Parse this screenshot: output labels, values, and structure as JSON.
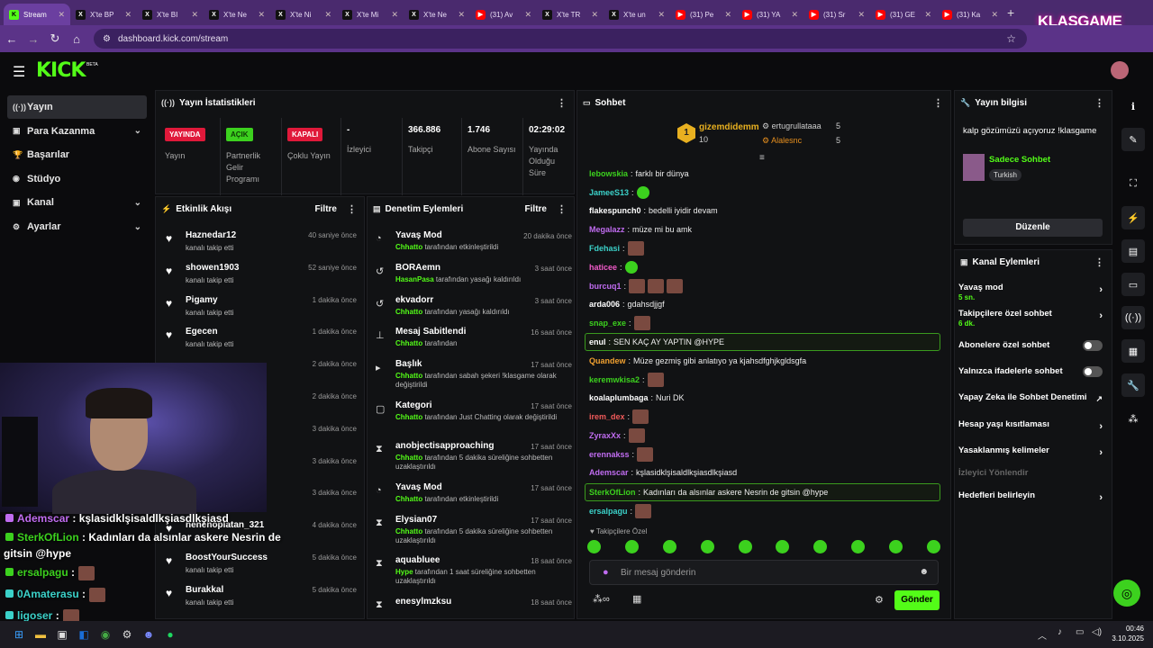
{
  "browser": {
    "tabs": [
      {
        "icon": "kick",
        "label": "Stream"
      },
      {
        "icon": "x",
        "label": "X'te BP"
      },
      {
        "icon": "x",
        "label": "X'te BI"
      },
      {
        "icon": "x",
        "label": "X'te Ne"
      },
      {
        "icon": "x",
        "label": "X'te Ni"
      },
      {
        "icon": "x",
        "label": "X'te Mi"
      },
      {
        "icon": "x",
        "label": "X'te Ne"
      },
      {
        "icon": "yt",
        "label": "(31) Av"
      },
      {
        "icon": "x",
        "label": "X'te TR"
      },
      {
        "icon": "x",
        "label": "X'te un"
      },
      {
        "icon": "yt",
        "label": "(31) Pe"
      },
      {
        "icon": "yt",
        "label": "(31) YA"
      },
      {
        "icon": "yt",
        "label": "(31) Sr"
      },
      {
        "icon": "yt",
        "label": "(31) GE"
      },
      {
        "icon": "yt",
        "label": "(31) Ka"
      }
    ],
    "url": "dashboard.kick.com/stream",
    "overlay_logo": "KLASGAME"
  },
  "sidebar": {
    "items": [
      {
        "icon": "((·))",
        "label": "Yayın"
      },
      {
        "icon": "▣",
        "label": "Para Kazanma"
      },
      {
        "icon": "🏆",
        "label": "Başarılar"
      },
      {
        "icon": "◉",
        "label": "Stüdyo"
      },
      {
        "icon": "▣",
        "label": "Kanal"
      },
      {
        "icon": "⚙",
        "label": "Ayarlar"
      }
    ]
  },
  "stats": {
    "title": "Yayın İstatistikleri",
    "cells": [
      {
        "badge": "YAYINDA",
        "label": "Yayın"
      },
      {
        "badge": "AÇIK",
        "label": "Partnerlik Gelir Programı"
      },
      {
        "badge": "KAPALI",
        "label": "Çoklu Yayın"
      },
      {
        "value": "-",
        "label": "İzleyici"
      },
      {
        "value": "366.886",
        "label": "Takipçi"
      },
      {
        "value": "1.746",
        "label": "Abone Sayısı"
      },
      {
        "value": "02:29:02",
        "label": "Yayında Olduğu Süre"
      }
    ]
  },
  "activity": {
    "title": "Etkinlik Akışı",
    "filter": "Filtre",
    "items": [
      {
        "name": "Haznedar12",
        "sub": "kanalı takip etti",
        "time": "40 saniye önce"
      },
      {
        "name": "showen1903",
        "sub": "kanalı takip etti",
        "time": "52 saniye önce"
      },
      {
        "name": "Pigamy",
        "sub": "kanalı takip etti",
        "time": "1 dakika önce"
      },
      {
        "name": "Egecen",
        "sub": "kanalı takip etti",
        "time": "1 dakika önce"
      },
      {
        "name": "",
        "sub": "",
        "time": "2 dakika önce"
      },
      {
        "name": "",
        "sub": "",
        "time": "2 dakika önce"
      },
      {
        "name": "",
        "sub": "",
        "time": "3 dakika önce"
      },
      {
        "name": "",
        "sub": "",
        "time": "3 dakika önce"
      },
      {
        "name": "",
        "sub": "",
        "time": "3 dakika önce"
      },
      {
        "name": "nenenoplatan_321",
        "sub": "",
        "time": "4 dakika önce"
      },
      {
        "name": "BoostYourSuccess",
        "sub": "kanalı takip etti",
        "time": "5 dakika önce"
      },
      {
        "name": "Burakkal",
        "sub": "kanalı takip etti",
        "time": "5 dakika önce"
      }
    ]
  },
  "moderation": {
    "title": "Denetim Eylemleri",
    "filter": "Filtre",
    "items": [
      {
        "icon": "◔",
        "name": "Yavaş Mod",
        "actor": "Chhatto",
        "sub": " tarafından etkinleştirildi",
        "time": "20 dakika önce"
      },
      {
        "icon": "↺",
        "name": "BORAemn",
        "actor": "HasanPasa",
        "sub": " tarafından yasağı kaldırıldı",
        "time": "3 saat önce"
      },
      {
        "icon": "↺",
        "name": "ekvadorr",
        "actor": "Chhatto",
        "sub": " tarafından yasağı kaldırıldı",
        "time": "3 saat önce"
      },
      {
        "icon": "⊥",
        "name": "Mesaj Sabitlendi",
        "actor": "Chhatto",
        "sub": " tarafından",
        "time": "16 saat önce"
      },
      {
        "icon": "▸",
        "name": "Başlık",
        "actor": "Chhatto",
        "sub": " tarafından sabah şekeri !klasgame olarak değiştirildi",
        "time": "17 saat önce"
      },
      {
        "icon": "▢",
        "name": "Kategori",
        "actor": "Chhatto",
        "sub": " tarafından Just Chatting olarak değiştirildi",
        "time": "17 saat önce"
      },
      {
        "icon": "⧗",
        "name": "anobjectisapproaching",
        "actor": "Chhatto",
        "sub": " tarafından 5 dakika süreliğine sohbetten uzaklaştırıldı",
        "time": "17 saat önce"
      },
      {
        "icon": "◔",
        "name": "Yavaş Mod",
        "actor": "Chhatto",
        "sub": " tarafından etkinleştirildi",
        "time": "17 saat önce"
      },
      {
        "icon": "⧗",
        "name": "Elysian07",
        "actor": "Chhatto",
        "sub": " tarafından 5 dakika süreliğine sohbetten uzaklaştırıldı",
        "time": "17 saat önce"
      },
      {
        "icon": "⧗",
        "name": "aquabluee",
        "actor": "Hype",
        "sub": " tarafından 1 saat süreliğine sohbetten uzaklaştırıldı",
        "time": "18 saat önce"
      },
      {
        "icon": "⧗",
        "name": "enesylmzksu",
        "actor": "",
        "sub": "",
        "time": "18 saat önce"
      }
    ]
  },
  "chat": {
    "title": "Sohbet",
    "top": [
      {
        "rank": "1",
        "name": "gizemdidemm",
        "count": "10"
      },
      {
        "name": "ertugrullataaa",
        "count": "5"
      },
      {
        "name": "Alalesnc",
        "count": "5"
      }
    ],
    "lines": [
      {
        "user": "lebowskia",
        "color": "#3cd11e",
        "text": "farklı bir dünya"
      },
      {
        "user": "JameeS13",
        "color": "#3bd1c9",
        "text": ""
      },
      {
        "user": "flakespunch0",
        "color": "#ffffff",
        "text": "bedelli iyidir devam"
      },
      {
        "user": "Megalazz",
        "color": "#c06cf0",
        "text": "müze mi bu amk"
      },
      {
        "user": "Fdehasi",
        "color": "#3bd1c9",
        "text": ""
      },
      {
        "user": "haticee",
        "color": "#f05ac8",
        "text": ""
      },
      {
        "user": "burcuq1",
        "color": "#c06cf0",
        "text": ""
      },
      {
        "user": "arda006",
        "color": "#ffffff",
        "text": "gdahsdjjgf"
      },
      {
        "user": "snap_exe",
        "color": "#3cd11e",
        "text": ""
      },
      {
        "user": "enul",
        "color": "#ffffff",
        "text": "SEN KAÇ AY YAPTIN @HYPE"
      },
      {
        "user": "Quandew",
        "color": "#f0a030",
        "text": "Müze gezmiş gibi anlatıyo ya kjahsdfghjkgldsgfa"
      },
      {
        "user": "keremwkisa2",
        "color": "#3cd11e",
        "text": ""
      },
      {
        "user": "koalaplumbaga",
        "color": "#ffffff",
        "text": "Nuri DK"
      },
      {
        "user": "irem_dex",
        "color": "#f05a5a",
        "text": ""
      },
      {
        "user": "ZyraxXx",
        "color": "#c06cf0",
        "text": ""
      },
      {
        "user": "erennakss",
        "color": "#c06cf0",
        "text": ""
      },
      {
        "user": "Ademscar",
        "color": "#c06cf0",
        "text": "kşlasidklşisaldlkşiasdlkşiasd"
      },
      {
        "user": "SterkOfLion",
        "color": "#3cd11e",
        "text": "Kadınları da alsınlar askere Nesrin de gitsin @hype"
      },
      {
        "user": "ersalpagu",
        "color": "#3bd1c9",
        "text": ""
      }
    ],
    "mode": "Takipçilere Özel",
    "placeholder": "Bir mesaj gönderin",
    "send": "Gönder"
  },
  "info": {
    "title": "Yayın bilgisi",
    "stream_title": "kalp gözümüzü açıyoruz !klasgame",
    "category": "Sadece Sohbet",
    "language": "Turkish",
    "edit": "Düzenle"
  },
  "channel_actions": {
    "title": "Kanal Eylemleri",
    "items": [
      {
        "label": "Yavaş mod",
        "sub": "5 sn.",
        "ctrl": "chev"
      },
      {
        "label": "Takipçilere özel sohbet",
        "sub": "6 dk.",
        "ctrl": "chev"
      },
      {
        "label": "Abonelere özel sohbet",
        "sub": "",
        "ctrl": "toggle"
      },
      {
        "label": "Yalnızca ifadelerle sohbet",
        "sub": "",
        "ctrl": "toggle"
      },
      {
        "label": "Yapay Zeka ile Sohbet Denetimi",
        "sub": "",
        "ctrl": "ext"
      },
      {
        "label": "Hesap yaşı kısıtlaması",
        "sub": "",
        "ctrl": "chev"
      },
      {
        "label": "Yasaklanmış kelimeler",
        "sub": "",
        "ctrl": "chev"
      },
      {
        "label": "İzleyici Yönlendir",
        "sub": "",
        "ctrl": "none"
      },
      {
        "label": "Hedefleri belirleyin",
        "sub": "",
        "ctrl": "chev"
      }
    ]
  },
  "overlay_chat": [
    {
      "user": "Ademscar",
      "color": "#c06cf0",
      "text": " : kşlasidklşisaldlkşiasdlkşiasd"
    },
    {
      "user": "SterkOfLion",
      "color": "#3cd11e",
      "text": " : Kadınları da alsınlar askere Nesrin de"
    },
    {
      "user": "",
      "color": "#fff",
      "text": "gitsin @hype"
    },
    {
      "user": "ersalpagu",
      "color": "#3cd11e",
      "text": " :"
    },
    {
      "user": "0Amaterasu",
      "color": "#3bd1c9",
      "text": " :"
    },
    {
      "user": "ligoser",
      "color": "#3bd1c9",
      "text": " :"
    }
  ],
  "taskbar": {
    "time": "00:46",
    "date": "3.10.2025"
  }
}
